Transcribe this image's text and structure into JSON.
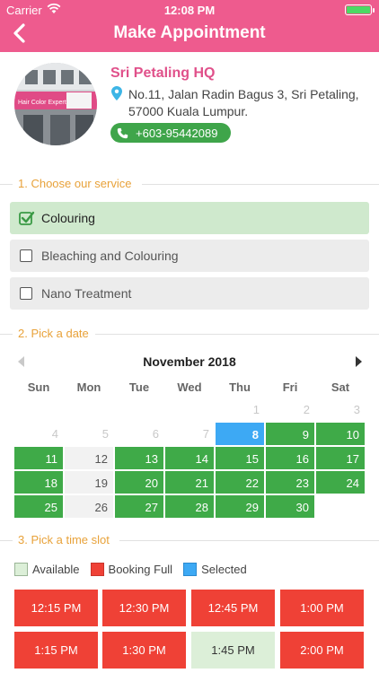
{
  "status_bar": {
    "carrier": "Carrier",
    "time": "12:08 PM"
  },
  "nav": {
    "title": "Make Appointment"
  },
  "branch": {
    "name": "Sri Petaling HQ",
    "address": "No.11, Jalan Radin Bagus 3, Sri Petaling, 57000 Kuala Lumpur.",
    "phone": "+603-95442089",
    "photo_sign": "Hair Color Expert"
  },
  "sections": {
    "service": "1. Choose our service",
    "date": "2. Pick a date",
    "time": "3. Pick a time slot"
  },
  "services": [
    {
      "label": "Colouring",
      "selected": true
    },
    {
      "label": "Bleaching and Colouring",
      "selected": false
    },
    {
      "label": "Nano Treatment",
      "selected": false
    }
  ],
  "calendar": {
    "month": "November",
    "year": "2018",
    "weekdays": [
      "Sun",
      "Mon",
      "Tue",
      "Wed",
      "Thu",
      "Fri",
      "Sat"
    ],
    "days": [
      {
        "d": "1",
        "s": "past"
      },
      {
        "d": "2",
        "s": "past"
      },
      {
        "d": "3",
        "s": "past"
      },
      {
        "d": "4",
        "s": "past"
      },
      {
        "d": "5",
        "s": "past"
      },
      {
        "d": "6",
        "s": "past"
      },
      {
        "d": "7",
        "s": "past"
      },
      {
        "d": "8",
        "s": "sel"
      },
      {
        "d": "9",
        "s": "avail"
      },
      {
        "d": "10",
        "s": "avail"
      },
      {
        "d": "11",
        "s": "avail"
      },
      {
        "d": "12",
        "s": "closed"
      },
      {
        "d": "13",
        "s": "avail"
      },
      {
        "d": "14",
        "s": "avail"
      },
      {
        "d": "15",
        "s": "avail"
      },
      {
        "d": "16",
        "s": "avail"
      },
      {
        "d": "17",
        "s": "avail"
      },
      {
        "d": "18",
        "s": "avail"
      },
      {
        "d": "19",
        "s": "closed"
      },
      {
        "d": "20",
        "s": "avail"
      },
      {
        "d": "21",
        "s": "avail"
      },
      {
        "d": "22",
        "s": "avail"
      },
      {
        "d": "23",
        "s": "avail"
      },
      {
        "d": "24",
        "s": "avail"
      },
      {
        "d": "25",
        "s": "avail"
      },
      {
        "d": "26",
        "s": "closed"
      },
      {
        "d": "27",
        "s": "avail"
      },
      {
        "d": "28",
        "s": "avail"
      },
      {
        "d": "29",
        "s": "avail"
      },
      {
        "d": "30",
        "s": "avail"
      }
    ],
    "first_weekday": 4
  },
  "legend": {
    "available": "Available",
    "full": "Booking Full",
    "selected": "Selected"
  },
  "slots": [
    {
      "time": "12:15 PM",
      "state": "full"
    },
    {
      "time": "12:30 PM",
      "state": "full"
    },
    {
      "time": "12:45 PM",
      "state": "full"
    },
    {
      "time": "1:00 PM",
      "state": "full"
    },
    {
      "time": "1:15 PM",
      "state": "full"
    },
    {
      "time": "1:30 PM",
      "state": "full"
    },
    {
      "time": "1:45 PM",
      "state": "available"
    },
    {
      "time": "2:00 PM",
      "state": "full"
    }
  ],
  "colors": {
    "header": "#ee5b8e",
    "branch_name": "#e0508a",
    "section_label": "#e8a23a",
    "available_day": "#3faa48",
    "selected_day": "#3da9f4",
    "booking_full": "#ef4136",
    "available_slot": "#dcefd8"
  }
}
